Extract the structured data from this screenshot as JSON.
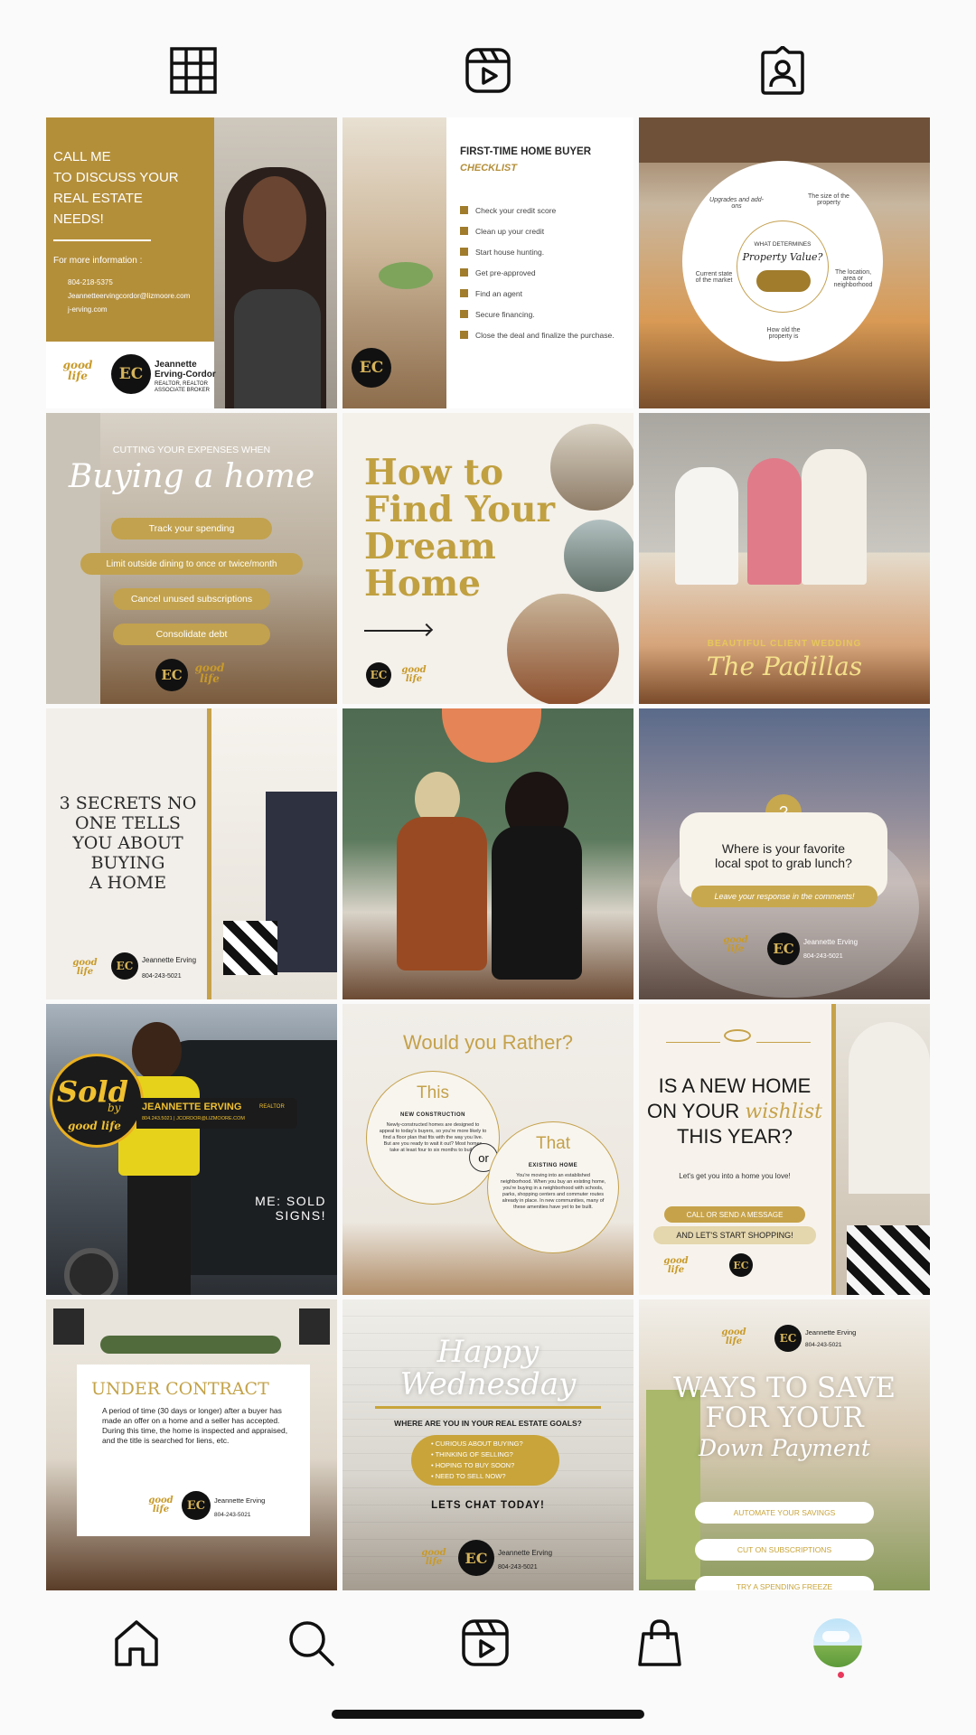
{
  "profile_tabs": {
    "grid": "grid-icon",
    "reels": "reels-icon",
    "tagged": "tagged-icon"
  },
  "posts": [
    {
      "label": "CALL ME TO DISCUSS YOUR REAL ESTATE NEEDS!",
      "title": "CALL ME\nTO DISCUSS YOUR\nREAL ESTATE\nNEEDS!",
      "more": "For more information :",
      "phone": "804-218-5375",
      "email": "Jeannetteervingcordor@lizmoore.com",
      "web": "j-erving.com",
      "name": "Jeannette\nErving-Cordor",
      "sub": "REALTOR, REALTOR\nASSOCIATE BROKER"
    },
    {
      "label": "FIRST-TIME HOME BUYER CHECKLIST",
      "title": "FIRST-TIME HOME BUYER",
      "subtitle": "CHECKLIST",
      "items": [
        "Check your credit score",
        "Clean up your credit",
        "Start house hunting.",
        "Get pre-approved",
        "Find an agent",
        "Secure financing.",
        "Close the deal and finalize the purchase."
      ]
    },
    {
      "label": "WHAT DETERMINES Property Value?",
      "center_top": "WHAT DETERMINES",
      "center_main": "Property Value?",
      "segments": [
        "Upgrades and add-ons",
        "The size of the property",
        "Current state of the market",
        "The location, area or neighborhood",
        "How old the property is"
      ]
    },
    {
      "label": "CUTTING YOUR EXPENSES WHEN Buying a home",
      "kicker": "CUTTING YOUR EXPENSES WHEN",
      "title": "Buying a home",
      "items": [
        "Track your spending",
        "Limit outside dining to once or twice/month",
        "Cancel unused subscriptions",
        "Consolidate debt"
      ]
    },
    {
      "label": "How to Find Your Dream Home",
      "title": "How to\nFind Your\nDream\nHome"
    },
    {
      "label": "BEAUTIFUL CLIENT WEDDING The Padillas",
      "kicker": "BEAUTIFUL CLIENT WEDDING",
      "title": "The Padillas"
    },
    {
      "label": "3 SECRETS NO ONE TELLS YOU ABOUT BUYING A HOME",
      "title": "3 SECRETS NO\nONE TELLS\nYOU ABOUT\nBUYING\nA HOME",
      "name": "Jeannette Erving",
      "phone": "804-243-5021"
    },
    {
      "label": "Clients on sofa"
    },
    {
      "label": "Where is your favorite local spot to grab lunch?",
      "badge": "?",
      "question": "Where is your favorite\nlocal spot to grab lunch?",
      "cta": "Leave your response in the comments!",
      "name": "Jeannette Erving",
      "phone": "804-243-5021"
    },
    {
      "label": "ME: SOLD SIGNS!",
      "caption": "ME: SOLD\nSIGNS!",
      "sold": "Sold",
      "by": "by",
      "brand": "good life",
      "banner": "JEANNETTE ERVING",
      "banner_suffix": "REALTOR",
      "banner_sub": "804.243.5021 | JCORDOR@LIZMOORE.COM"
    },
    {
      "label": "Would you Rather?",
      "title": "Would you Rather?",
      "this": "This",
      "this_sub": "NEW CONSTRUCTION",
      "this_body": "Newly-constructed homes are designed to appeal to today's buyers, so you're more likely to find a floor plan that fits with the way you live. But are you ready to wait it out? Most homes take at least four to six months to build.",
      "or": "or",
      "that": "That",
      "that_sub": "EXISTING HOME",
      "that_body": "You're moving into an established neighborhood. When you buy an existing home, you're buying in a neighborhood with schools, parks, shopping centers and commuter routes already in place. In new communities, many of these amenities have yet to be built."
    },
    {
      "label": "IS A NEW HOME ON YOUR wishlist THIS YEAR?",
      "line1": "IS A NEW HOME",
      "line2a": "ON YOUR ",
      "line2b": "wishlist",
      "line3": "THIS YEAR?",
      "sub": "Let's get you into a home you love!",
      "cta1": "CALL OR SEND A MESSAGE",
      "cta2": "AND LET'S START SHOPPING!"
    },
    {
      "label": "UNDER CONTRACT",
      "title": "UNDER CONTRACT",
      "body": "A period of time (30 days or longer) after a buyer has made an offer on a home and a seller has accepted. During this time, the home is inspected and appraised, and the title is searched for liens, etc.",
      "name": "Jeannette Erving",
      "phone": "804-243-5021"
    },
    {
      "label": "Happy Wednesday",
      "title": "Happy\nWednesday",
      "question": "WHERE ARE YOU IN YOUR REAL ESTATE GOALS?",
      "items": [
        "• CURIOUS ABOUT BUYING?",
        "• THINKING OF SELLING?",
        "• HOPING TO BUY SOON?",
        "• NEED TO SELL NOW?"
      ],
      "cta": "LETS CHAT TODAY!",
      "name": "Jeannette Erving",
      "phone": "804-243-5021"
    },
    {
      "label": "WAYS TO SAVE FOR YOUR Down Payment",
      "title": "WAYS TO SAVE\nFOR YOUR",
      "script": "Down Payment",
      "items": [
        "AUTOMATE YOUR SAVINGS",
        "CUT ON SUBSCRIPTIONS",
        "TRY A SPENDING FREEZE"
      ],
      "name": "Jeannette Erving",
      "phone": "804-243-5021"
    }
  ],
  "bottom_nav": {
    "home": "home-icon",
    "search": "search-icon",
    "reels": "reels-icon",
    "shop": "shop-icon",
    "profile": "profile-avatar"
  }
}
